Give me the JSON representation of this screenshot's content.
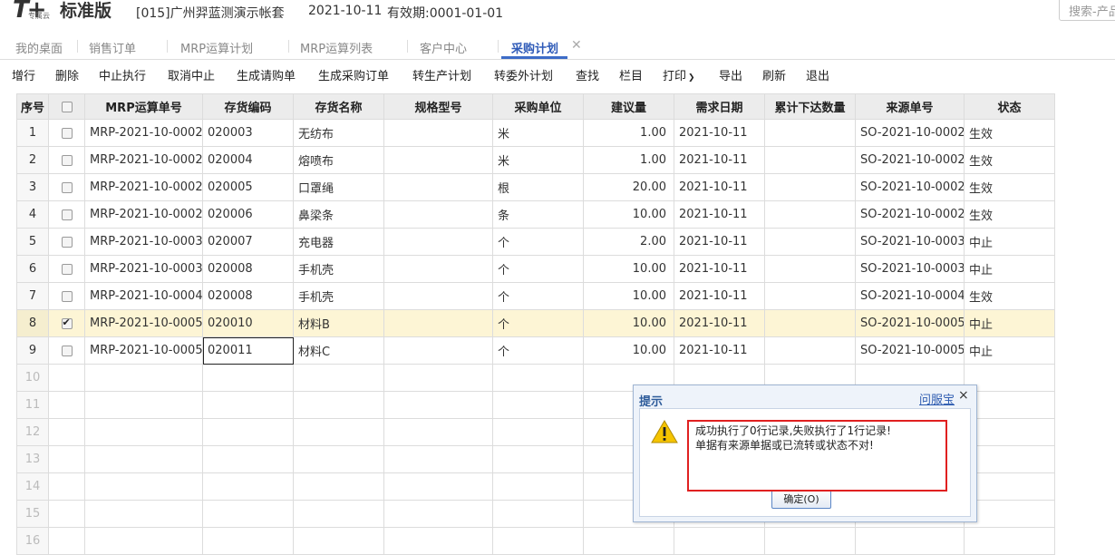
{
  "header": {
    "logo_mark": "T+",
    "logo_sub": "专属云",
    "edition": "标准版",
    "company": "[015]广州羿蓝测演示帐套",
    "date": "2021-10-11",
    "valid": "有效期:0001-01-01",
    "search_placeholder": "搜索-产品"
  },
  "tabs": [
    {
      "label": "我的桌面"
    },
    {
      "label": "销售订单"
    },
    {
      "label": "MRP运算计划"
    },
    {
      "label": "MRP运算列表"
    },
    {
      "label": "客户中心"
    },
    {
      "label": "采购计划",
      "active": true
    }
  ],
  "toolbar": {
    "items": [
      "增行",
      "删除",
      "中止执行",
      "取消中止",
      "生成请购单",
      "生成采购订单",
      "转生产计划",
      "转委外计划",
      "查找",
      "栏目",
      "打印",
      "导出",
      "刷新",
      "退出"
    ]
  },
  "grid": {
    "columns": [
      "序号",
      "",
      "MRP运算单号",
      "存货编码",
      "存货名称",
      "规格型号",
      "采购单位",
      "建议量",
      "需求日期",
      "累计下达数量",
      "来源单号",
      "状态"
    ],
    "rows": [
      {
        "no": "1",
        "checked": false,
        "mrp": "MRP-2021-10-0002",
        "code": "020003",
        "name": "无纺布",
        "spec": "",
        "unit": "米",
        "qty": "1.00",
        "date": "2021-10-11",
        "issued": "",
        "src": "SO-2021-10-0002",
        "status": "生效"
      },
      {
        "no": "2",
        "checked": false,
        "mrp": "MRP-2021-10-0002",
        "code": "020004",
        "name": "熔喷布",
        "spec": "",
        "unit": "米",
        "qty": "1.00",
        "date": "2021-10-11",
        "issued": "",
        "src": "SO-2021-10-0002",
        "status": "生效"
      },
      {
        "no": "3",
        "checked": false,
        "mrp": "MRP-2021-10-0002",
        "code": "020005",
        "name": "口罩绳",
        "spec": "",
        "unit": "根",
        "qty": "20.00",
        "date": "2021-10-11",
        "issued": "",
        "src": "SO-2021-10-0002",
        "status": "生效"
      },
      {
        "no": "4",
        "checked": false,
        "mrp": "MRP-2021-10-0002",
        "code": "020006",
        "name": "鼻梁条",
        "spec": "",
        "unit": "条",
        "qty": "10.00",
        "date": "2021-10-11",
        "issued": "",
        "src": "SO-2021-10-0002",
        "status": "生效"
      },
      {
        "no": "5",
        "checked": false,
        "mrp": "MRP-2021-10-0003",
        "code": "020007",
        "name": "充电器",
        "spec": "",
        "unit": "个",
        "qty": "2.00",
        "date": "2021-10-11",
        "issued": "",
        "src": "SO-2021-10-0003",
        "status": "中止"
      },
      {
        "no": "6",
        "checked": false,
        "mrp": "MRP-2021-10-0003",
        "code": "020008",
        "name": "手机壳",
        "spec": "",
        "unit": "个",
        "qty": "10.00",
        "date": "2021-10-11",
        "issued": "",
        "src": "SO-2021-10-0003",
        "status": "中止"
      },
      {
        "no": "7",
        "checked": false,
        "mrp": "MRP-2021-10-0004",
        "code": "020008",
        "name": "手机壳",
        "spec": "",
        "unit": "个",
        "qty": "10.00",
        "date": "2021-10-11",
        "issued": "",
        "src": "SO-2021-10-0004",
        "status": "生效"
      },
      {
        "no": "8",
        "checked": true,
        "mrp": "MRP-2021-10-0005",
        "code": "020010",
        "name": "材料B",
        "spec": "",
        "unit": "个",
        "qty": "10.00",
        "date": "2021-10-11",
        "issued": "",
        "src": "SO-2021-10-0005",
        "status": "中止"
      },
      {
        "no": "9",
        "checked": false,
        "mrp": "MRP-2021-10-0005",
        "code": "020011",
        "name": "材料C",
        "spec": "",
        "unit": "个",
        "qty": "10.00",
        "date": "2021-10-11",
        "issued": "",
        "src": "SO-2021-10-0005",
        "status": "中止"
      }
    ],
    "empty_row_numbers": [
      "10",
      "11",
      "12",
      "13",
      "14",
      "15",
      "16"
    ]
  },
  "dialog": {
    "title": "提示",
    "help_link": "问服宝",
    "close_glyph": "×",
    "message_line1": "成功执行了0行记录,失败执行了1行记录!",
    "message_line2": "单据有来源单据或已流转或状态不对!",
    "ok_label": "确定(O)",
    "icon": "warning-icon"
  },
  "colors": {
    "accent": "#3d6cc7",
    "selected_row": "#fdf5d5",
    "header_bg": "#ececec",
    "highlight_box": "#e02020",
    "warning": "#f5c400"
  }
}
